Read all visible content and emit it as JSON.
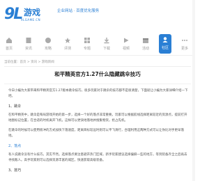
{
  "header": {
    "logo_main": "9L",
    "logo_cn": "游戏",
    "logo_sub": "9LGAME.CN",
    "slogan": "企业网站 · 百度优化服务"
  },
  "nav": {
    "items": [
      {
        "label": "首页",
        "icon": "home-icon"
      },
      {
        "label": "资讯",
        "icon": "news-icon"
      },
      {
        "label": "攻略",
        "icon": "guide-icon"
      },
      {
        "label": "评测",
        "icon": "review-icon"
      },
      {
        "label": "专题",
        "icon": "topic-icon"
      },
      {
        "label": "下载",
        "icon": "download-icon"
      },
      {
        "label": "视频",
        "icon": "video-icon"
      },
      {
        "label": "活动",
        "icon": "event-icon"
      },
      {
        "label": "社区",
        "icon": "community-icon"
      },
      {
        "label": "更多",
        "icon": "more-icon"
      }
    ],
    "active_index": 8,
    "accent_color": "#2a7fd4"
  },
  "breadcrumb": "当前位置：首页 > 资讯 > 游戏新闻",
  "article": {
    "title": "和平精英官方1.27什么隐藏跳伞技巧",
    "paragraphs": [
      "今日小编为大家带来和平精英官方1.27版本跳伞技巧，很多玩家对于跳伞的技巧都不是很清楚，下面就让小编为大家详细介绍一下吧。",
      "1、跳伞",
      "在和平精英中，跳伞是每局游戏开始的第一步，选择一个好的落点非常重要。玩家可以根据航线选择距离较近的资源点，提前打开地图标记位置，在合适的时机离开飞机，这样可以更快地落地并搜集物资，抢占先机。",
      "在跳伞的时候可以使用俯冲的方式加快下落速度，距离目标较远时则可以平飞滑行，合理利用这两种方式可以让你比对手更早落地。",
      "2、落点",
      "有人说跳伞没有什么技巧，其实不然。选择落点要注意避开热门区域，新手玩家建议选择偏僻一些的地方，等到装备齐全之后再去寻找敌人。高手玩家则可以选择资源丰富的城区，快速获取高级装备。",
      "3、技巧"
    ]
  }
}
